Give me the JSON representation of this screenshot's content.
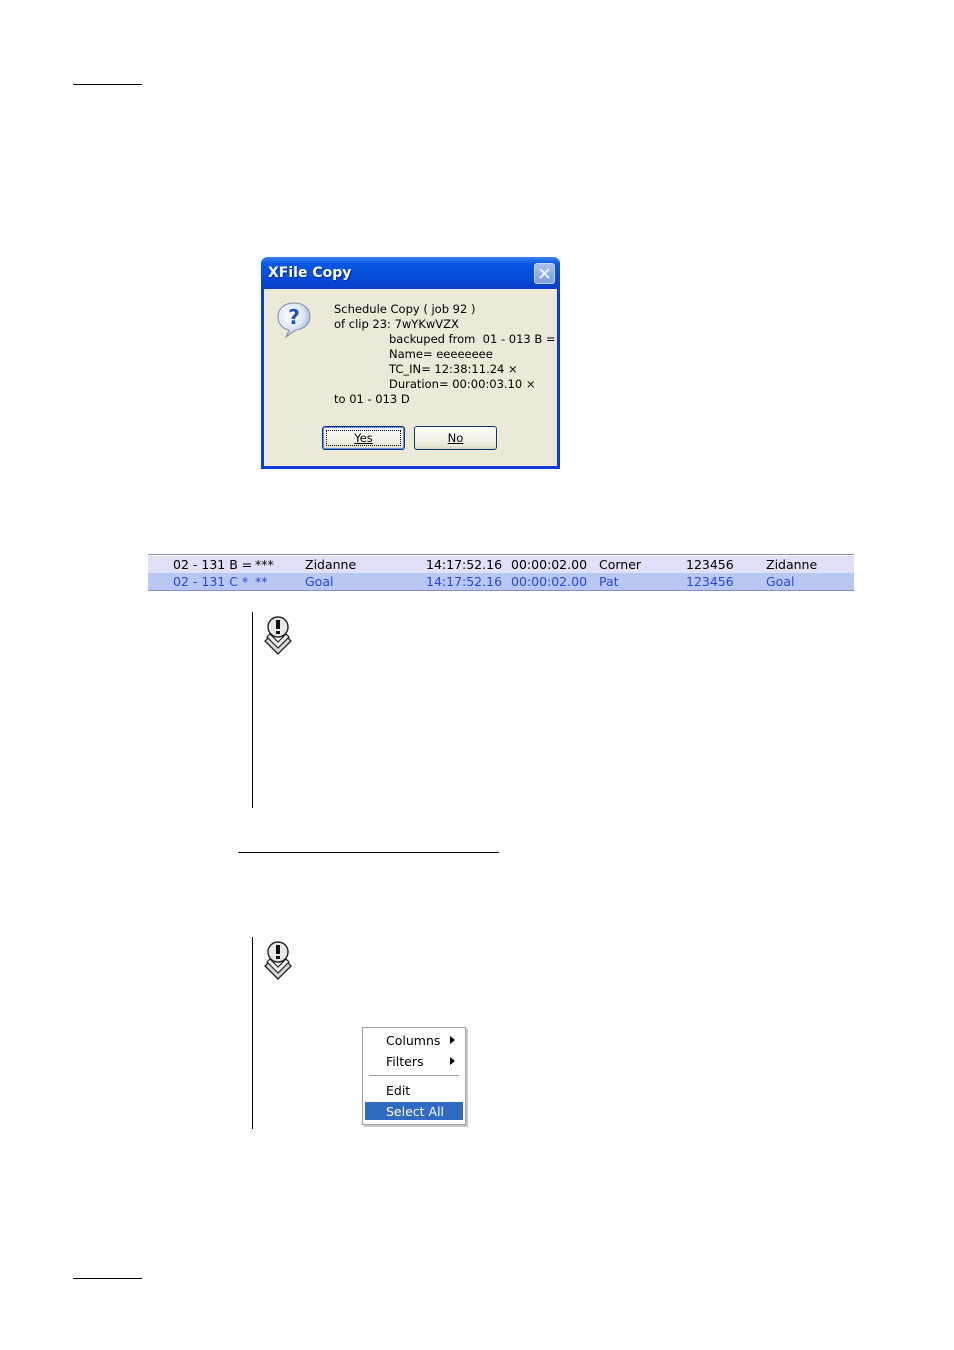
{
  "dialog": {
    "title": "XFile Copy",
    "icon": "question-icon",
    "lines": {
      "l1": "Schedule Copy ( job 92 )",
      "l2": "of clip 23: 7wYKwVZX",
      "l3": "backuped from  01 - 013 B =",
      "l4": "Name= eeeeeeee",
      "l5": "TC_IN= 12:38:11.24 ×",
      "l6": "Duration= 00:00:03.10 ×",
      "l7": "to 01 - 013 D"
    },
    "yes_label": "Yes",
    "no_label": "No"
  },
  "table": {
    "rows": [
      {
        "id": "02 - 131 B =",
        "rating": "***",
        "name": "Zidanne",
        "tc_in": "14:17:52.16",
        "duration": "00:00:02.00",
        "keyword": "Corner",
        "code": "123456",
        "player": "Zidanne"
      },
      {
        "id": "02 - 131 C *",
        "rating": "**",
        "name": "Goal",
        "tc_in": "14:17:52.16",
        "duration": "00:00:02.00",
        "keyword": "Pat",
        "code": "123456",
        "player": "Goal"
      }
    ],
    "colors": {
      "row1_bg": "#e0e0f8",
      "row2_bg": "#b8c8f2",
      "row2_text": "#2d45d8"
    }
  },
  "notes": {
    "icon": "note-icon"
  },
  "context_menu": {
    "items": [
      "Columns",
      "Filters",
      "Edit",
      "Select All"
    ],
    "selected": "Select All",
    "highlight_color": "#316ac5"
  }
}
